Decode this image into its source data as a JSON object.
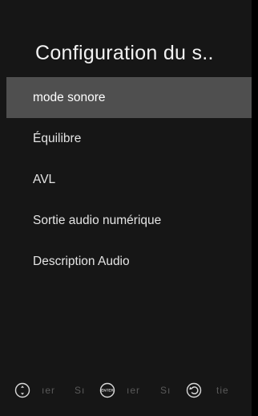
{
  "title": "Configuration du s..",
  "menu": {
    "items": [
      {
        "label": "mode sonore",
        "selected": true
      },
      {
        "label": "Équilibre",
        "selected": false
      },
      {
        "label": "AVL",
        "selected": false
      },
      {
        "label": "Sortie audio numérique",
        "selected": false
      },
      {
        "label": "Description Audio",
        "selected": false
      }
    ]
  },
  "hints": {
    "items": [
      {
        "icon": "arrows-icon",
        "label": "ıer"
      },
      {
        "label": "Sı"
      },
      {
        "icon": "enter-icon",
        "icon_text": "ENTER",
        "label": "ıer"
      },
      {
        "label": "Sı"
      },
      {
        "icon": "back-icon",
        "label": "tie"
      }
    ]
  },
  "colors": {
    "background": "#161616",
    "selected_row": "#4f4f4f",
    "text": "#e4e4e4",
    "hint_text": "#5a5a5a"
  }
}
